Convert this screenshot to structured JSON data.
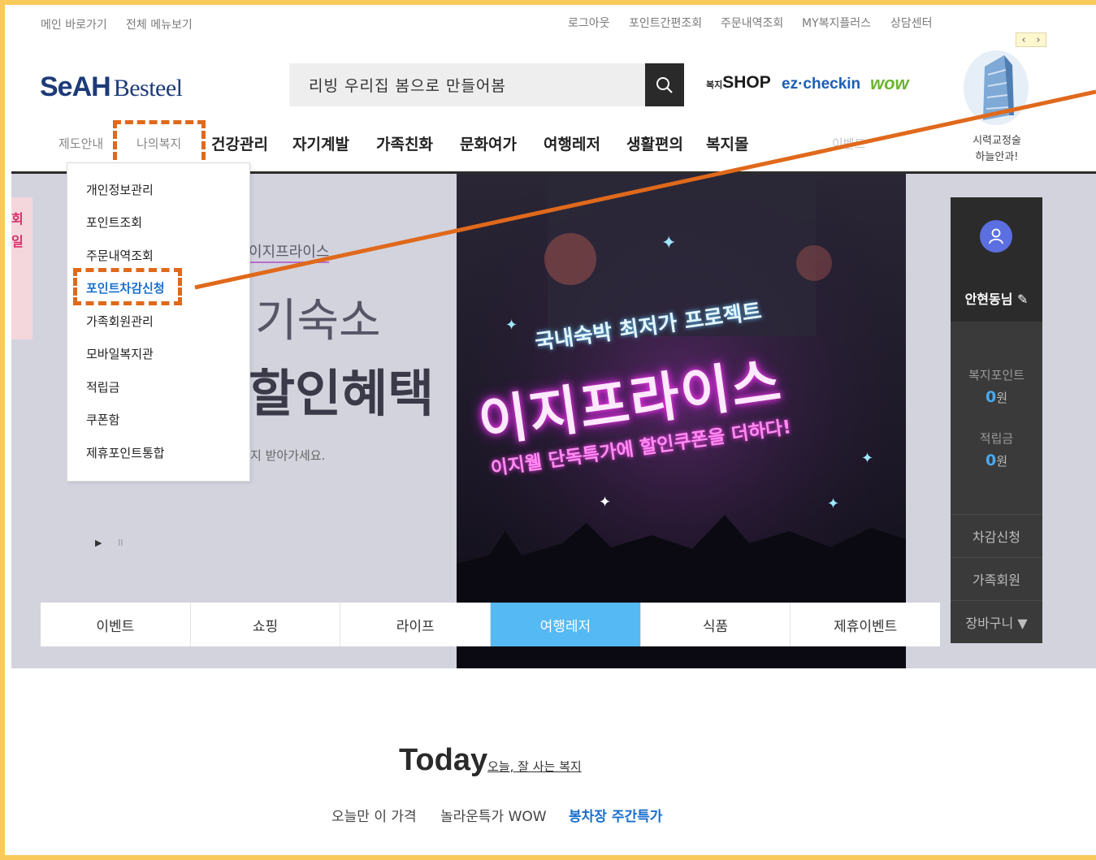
{
  "top_left_links": [
    "메인 바로가기",
    "전체 메뉴보기"
  ],
  "top_right_links": [
    "로그아웃",
    "포인트간편조회",
    "주문내역조회",
    "MY복지플러스",
    "상담센터"
  ],
  "logo": {
    "main": "SeAH",
    "sub": "Besteel"
  },
  "search": {
    "value": "리빙 우리집 봄으로 만들어봄"
  },
  "brand_links": {
    "shop_prefix": "복지",
    "shop": "SHOP",
    "checkin": "ez·checkin",
    "wow": "wow"
  },
  "nav": {
    "light_items": [
      "제도안내",
      "나의복지"
    ],
    "items": [
      "건강관리",
      "자기계발",
      "가족친화",
      "문화여가",
      "여행레저",
      "생활편의",
      "복지몰"
    ],
    "faded_item": "이벤트"
  },
  "side_promo": {
    "line1": "시력교정술",
    "line2": "하늘안과!",
    "arrow_prev": "‹",
    "arrow_next": "›"
  },
  "dropdown_menu": {
    "items": [
      "개인정보관리",
      "포인트조회",
      "주문내역조회",
      "포인트차감신청",
      "가족회원관리",
      "모바일복지관",
      "적립금",
      "쿠폰함",
      "제휴포인트통합"
    ],
    "active_index": 3
  },
  "hero": {
    "label": "이지프라이스",
    "line1": "기숙소",
    "line2": "할인혜택",
    "caption": "지 받아가세요.",
    "left_peek": [
      "회",
      "일"
    ],
    "controls": {
      "play": "▶",
      "pause": "II"
    },
    "poster": {
      "top": "국내숙박 최저가 프로젝트",
      "main": "이지프라이스",
      "sub1": "이지웰 단독특가에 할인쿠폰을 더하다!"
    }
  },
  "tabs": {
    "items": [
      "이벤트",
      "쇼핑",
      "라이프",
      "여행레저",
      "식품",
      "제휴이벤트"
    ],
    "active_index": 3
  },
  "user_panel": {
    "name": "안현동님",
    "welfare_label": "복지포인트",
    "welfare_value": "0",
    "reserve_label": "적립금",
    "reserve_value": "0",
    "unit": "원",
    "actions": [
      "차감신청",
      "가족회원",
      "장바구니 ▼"
    ]
  },
  "today": {
    "title": "Today",
    "subtitle": "오늘, 잘 사는 복지",
    "tabs": [
      "오늘만 이 가격",
      "놀라운특가 WOW",
      "봉차장 주간특가"
    ],
    "active_index": 2
  },
  "colors": {
    "accent": "#55b9f3",
    "annotation": "#e0691b",
    "frame": "#f9c95a",
    "link_blue": "#1a6fcf"
  }
}
